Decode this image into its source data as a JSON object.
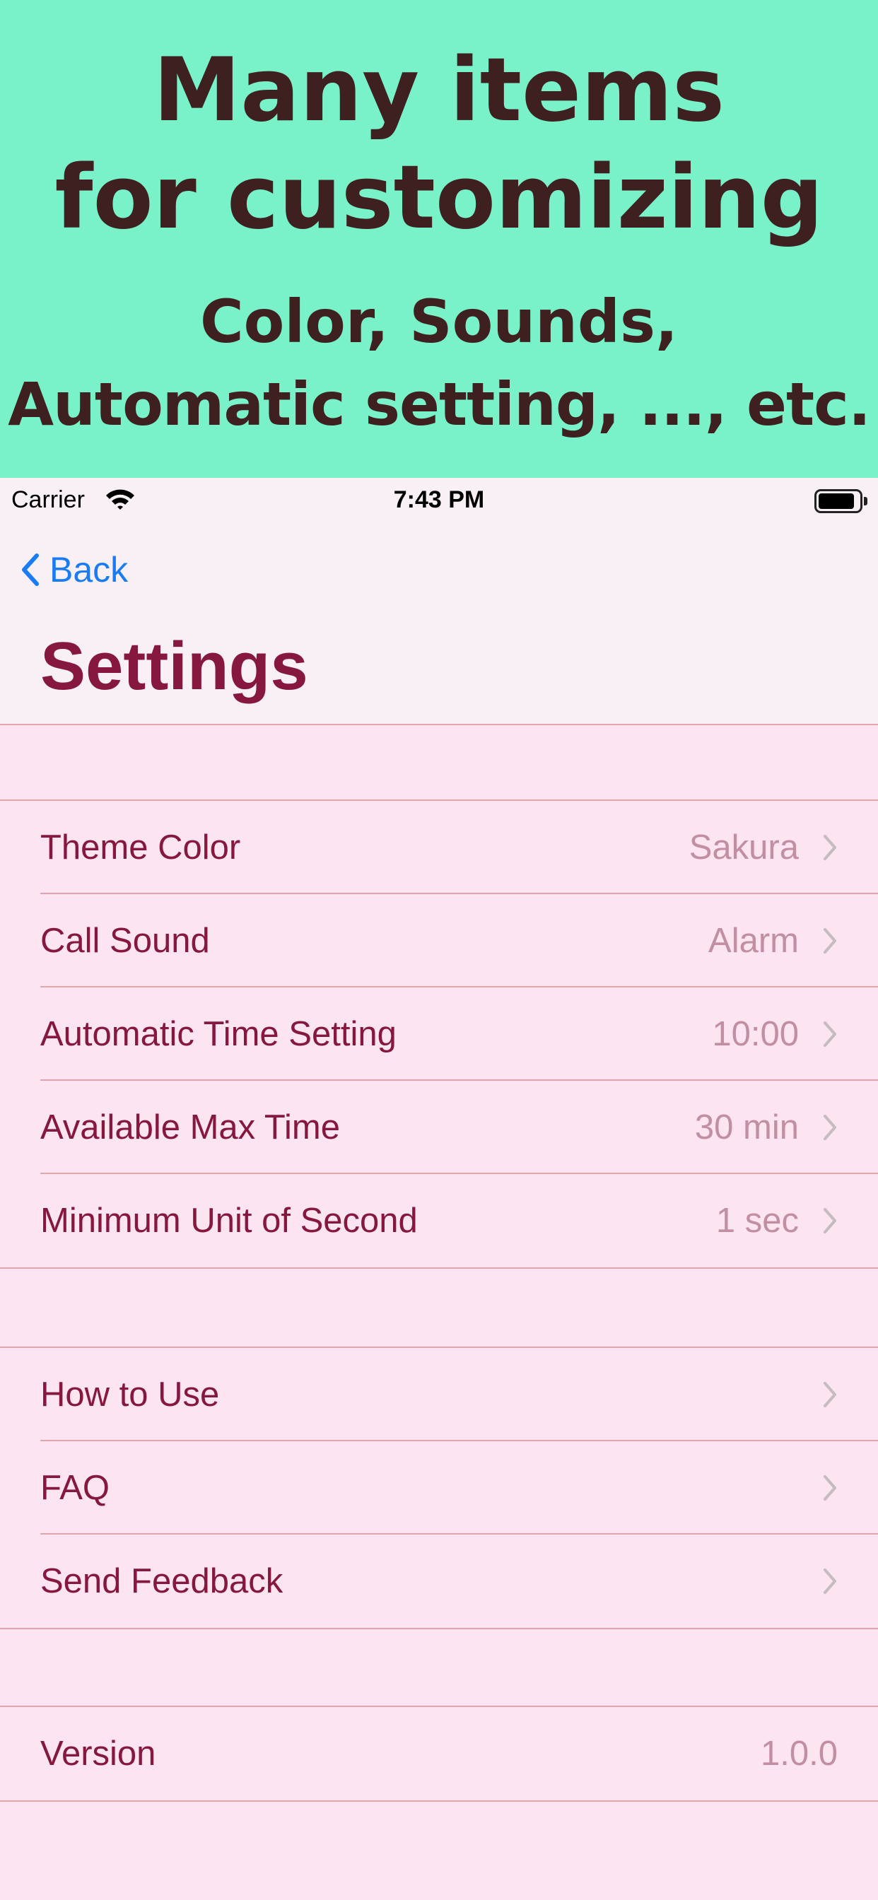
{
  "promo": {
    "line1": "Many items",
    "line2": "for customizing",
    "line3": "Color, Sounds,",
    "line4": "Automatic setting, ..., etc."
  },
  "status_bar": {
    "carrier": "Carrier",
    "time": "7:43 PM"
  },
  "nav": {
    "back_label": "Back",
    "title": "Settings"
  },
  "settings_section": [
    {
      "label": "Theme Color",
      "value": "Sakura"
    },
    {
      "label": "Call Sound",
      "value": "Alarm"
    },
    {
      "label": "Automatic Time Setting",
      "value": "10:00"
    },
    {
      "label": "Available Max Time",
      "value": "30 min"
    },
    {
      "label": "Minimum Unit of Second",
      "value": "1 sec"
    }
  ],
  "help_section": [
    {
      "label": "How to Use"
    },
    {
      "label": "FAQ"
    },
    {
      "label": "Send Feedback"
    }
  ],
  "version_section": {
    "label": "Version",
    "value": "1.0.0"
  },
  "colors": {
    "promo_bg": "#7af2c9",
    "promo_text": "#3f2020",
    "accent_text": "#86173f",
    "secondary_text": "#c28ea2",
    "link_blue": "#1a7cf5",
    "list_bg": "#fce4f1",
    "separator": "#e3a5ac"
  },
  "icons": [
    "wifi-icon",
    "battery-icon",
    "back-chevron-icon",
    "disclosure-chevron-icon"
  ]
}
